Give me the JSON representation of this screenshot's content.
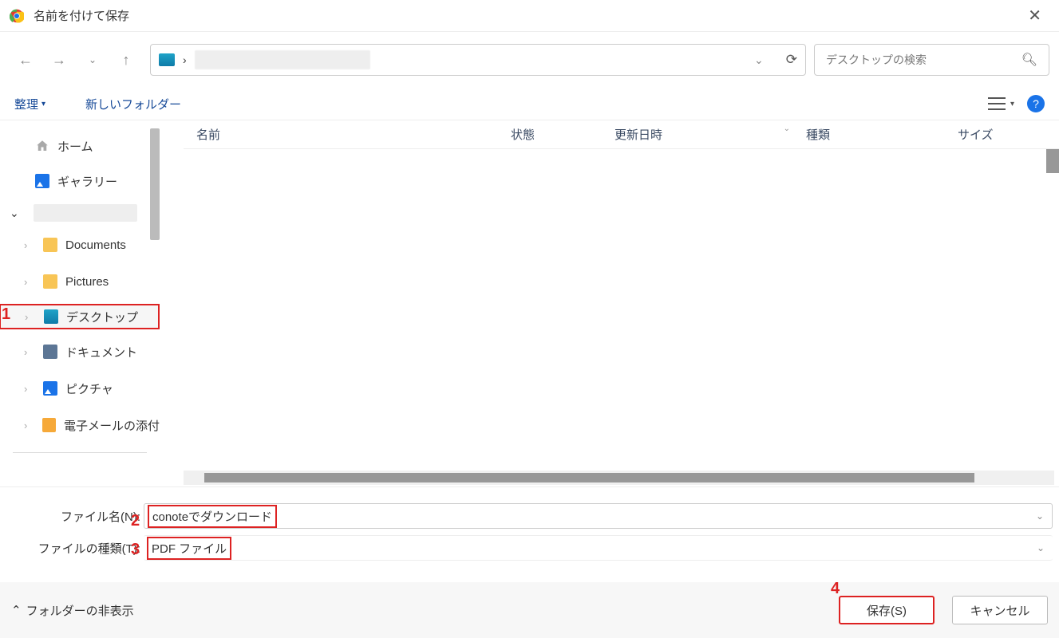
{
  "window": {
    "title": "名前を付けて保存"
  },
  "location": {
    "breadcrumb_sep": "›"
  },
  "search": {
    "placeholder": "デスクトップの検索"
  },
  "toolbar": {
    "organize": "整理",
    "new_folder": "新しいフォルダー"
  },
  "sidebar": {
    "home": "ホーム",
    "gallery": "ギャラリー",
    "items": [
      {
        "label": "Documents"
      },
      {
        "label": "Pictures"
      },
      {
        "label": "デスクトップ"
      },
      {
        "label": "ドキュメント"
      },
      {
        "label": "ピクチャ"
      },
      {
        "label": "電子メールの添付"
      }
    ]
  },
  "columns": {
    "name": "名前",
    "status": "状態",
    "date": "更新日時",
    "type": "種類",
    "size": "サイズ"
  },
  "form": {
    "filename_label": "ファイル名(N):",
    "filetype_label": "ファイルの種類(T):",
    "filename_value": "conoteでダウンロード",
    "filetype_value": "PDF ファイル"
  },
  "footer": {
    "hide_folders": "フォルダーの非表示",
    "save": "保存(S)",
    "cancel": "キャンセル"
  },
  "annotations": {
    "a1": "1",
    "a2": "2",
    "a3": "3",
    "a4": "4"
  }
}
